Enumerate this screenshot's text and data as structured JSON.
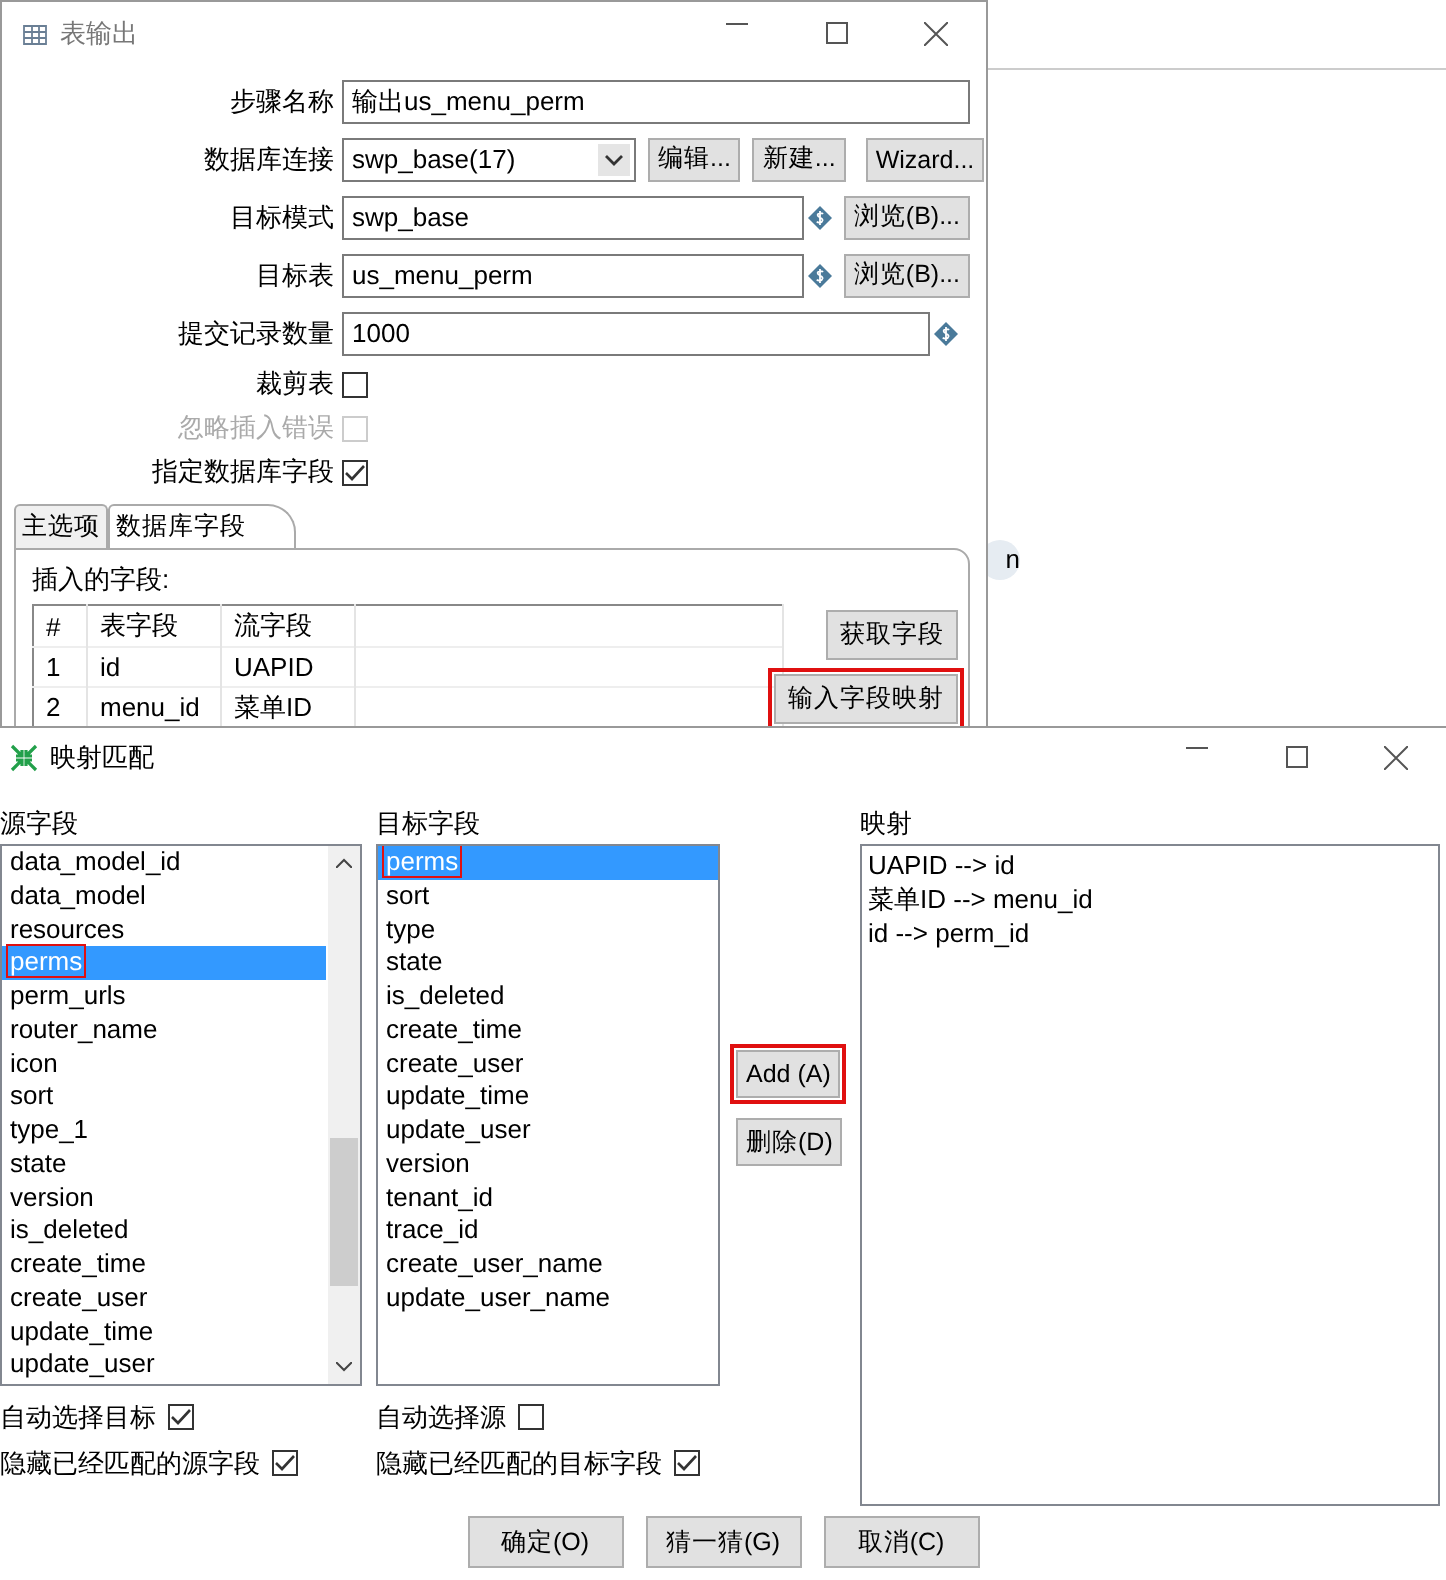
{
  "background": {
    "fragment": "n"
  },
  "table_output": {
    "title": "表输出",
    "form": [
      {
        "kind": "text",
        "label": "步骤名称",
        "value": "输出us_menu_perm"
      },
      {
        "kind": "combo",
        "label": "数据库连接",
        "value": "swp_base(17)",
        "buttons": [
          "编辑...",
          "新建...",
          "Wizard..."
        ]
      },
      {
        "kind": "text",
        "label": "目标模式",
        "value": "swp_base",
        "variable": true,
        "button": "浏览(B)..."
      },
      {
        "kind": "text",
        "label": "目标表",
        "value": "us_menu_perm",
        "variable": true,
        "button": "浏览(B)..."
      },
      {
        "kind": "text",
        "label": "提交记录数量",
        "value": "1000",
        "variable": true
      },
      {
        "kind": "check",
        "label": "裁剪表",
        "checked": false,
        "disabled": false
      },
      {
        "kind": "check",
        "label": "忽略插入错误",
        "checked": false,
        "disabled": true
      },
      {
        "kind": "check",
        "label": "指定数据库字段",
        "checked": true,
        "disabled": false
      }
    ],
    "tabs": [
      {
        "label": "主选项",
        "selected": false
      },
      {
        "label": "数据库字段",
        "selected": true
      }
    ],
    "fields_label": "插入的字段:",
    "table": {
      "columns": [
        "#",
        "表字段",
        "流字段"
      ],
      "rows": [
        [
          "1",
          "id",
          "UAPID"
        ],
        [
          "2",
          "menu_id",
          "菜单ID"
        ]
      ]
    },
    "buttons": [
      {
        "label": "获取字段",
        "highlighted": false
      },
      {
        "label": "输入字段映射",
        "highlighted": true
      }
    ]
  },
  "mapping_dialog": {
    "title": "映射匹配",
    "source": {
      "label": "源字段",
      "items": [
        {
          "text": "data_model_id",
          "selected": false,
          "highlighted": false
        },
        {
          "text": "data_model",
          "selected": false,
          "highlighted": false
        },
        {
          "text": "resources",
          "selected": false,
          "highlighted": false
        },
        {
          "text": "perms",
          "selected": true,
          "highlighted": true
        },
        {
          "text": "perm_urls",
          "selected": false,
          "highlighted": false
        },
        {
          "text": "router_name",
          "selected": false,
          "highlighted": false
        },
        {
          "text": "icon",
          "selected": false,
          "highlighted": false
        },
        {
          "text": "sort",
          "selected": false,
          "highlighted": false
        },
        {
          "text": "type_1",
          "selected": false,
          "highlighted": false
        },
        {
          "text": "state",
          "selected": false,
          "highlighted": false
        },
        {
          "text": "version",
          "selected": false,
          "highlighted": false
        },
        {
          "text": "is_deleted",
          "selected": false,
          "highlighted": false
        },
        {
          "text": "create_time",
          "selected": false,
          "highlighted": false
        },
        {
          "text": "create_user",
          "selected": false,
          "highlighted": false
        },
        {
          "text": "update_time",
          "selected": false,
          "highlighted": false
        },
        {
          "text": "update_user",
          "selected": false,
          "highlighted": false
        }
      ],
      "options": [
        {
          "label": "自动选择目标",
          "checked": true
        },
        {
          "label": "隐藏已经匹配的源字段",
          "checked": true
        }
      ]
    },
    "target": {
      "label": "目标字段",
      "items": [
        {
          "text": "perms",
          "selected": true,
          "highlighted": true
        },
        {
          "text": "sort",
          "selected": false,
          "highlighted": false
        },
        {
          "text": "type",
          "selected": false,
          "highlighted": false
        },
        {
          "text": "state",
          "selected": false,
          "highlighted": false
        },
        {
          "text": "is_deleted",
          "selected": false,
          "highlighted": false
        },
        {
          "text": "create_time",
          "selected": false,
          "highlighted": false
        },
        {
          "text": "create_user",
          "selected": false,
          "highlighted": false
        },
        {
          "text": "update_time",
          "selected": false,
          "highlighted": false
        },
        {
          "text": "update_user",
          "selected": false,
          "highlighted": false
        },
        {
          "text": "version",
          "selected": false,
          "highlighted": false
        },
        {
          "text": "tenant_id",
          "selected": false,
          "highlighted": false
        },
        {
          "text": "trace_id",
          "selected": false,
          "highlighted": false
        },
        {
          "text": "create_user_name",
          "selected": false,
          "highlighted": false
        },
        {
          "text": "update_user_name",
          "selected": false,
          "highlighted": false
        }
      ],
      "options": [
        {
          "label": "自动选择源",
          "checked": false
        },
        {
          "label": "隐藏已经匹配的目标字段",
          "checked": true
        }
      ]
    },
    "actions": [
      {
        "label": "Add (A)",
        "highlighted": true
      },
      {
        "label": "删除(D)",
        "highlighted": false
      }
    ],
    "mapping": {
      "label": "映射",
      "items": [
        "UAPID --> id",
        "菜单ID --> menu_id",
        "id --> perm_id"
      ]
    },
    "buttons": [
      "确定(O)",
      "猜一猜(G)",
      "取消(C)"
    ]
  }
}
